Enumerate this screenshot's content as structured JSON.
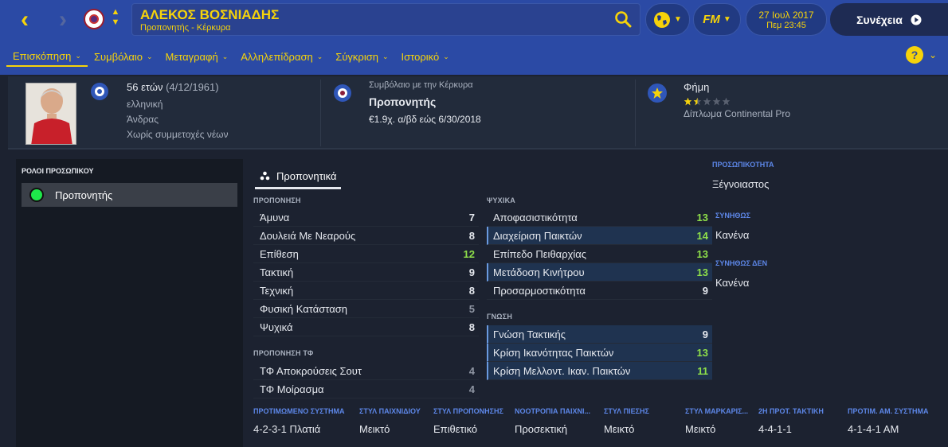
{
  "header": {
    "name": "ΑΛΕΚΟΣ ΒΟΣΝΙΑΔΗΣ",
    "subtitle": "Προπονητής - Κέρκυρα",
    "date": "27 Ιουλ 2017",
    "time": "Πεμ 23:45",
    "continue_label": "Συνέχεια",
    "fm_label": "FM",
    "icons": [
      "back-arrow",
      "forward-arrow",
      "club-badge",
      "up-down",
      "search",
      "globe",
      "fm-logo",
      "help"
    ]
  },
  "tabs": [
    "Επισκόπηση",
    "Συμβόλαιο",
    "Μεταγραφή",
    "Αλληλεπίδραση",
    "Σύγκριση",
    "Ιστορικό"
  ],
  "profile": {
    "age": "56 ετών",
    "dob": "(4/12/1961)",
    "nationality": "ελληνική",
    "gender": "Άνδρας",
    "youth": "Χωρίς συμμετοχές νέων",
    "contract_label": "Συμβόλαιο με την Κέρκυρα",
    "contract_role": "Προπονητής",
    "contract_terms": "€1.9χ. α/βδ εώς 6/30/2018",
    "reputation_label": "Φήμη",
    "reputation_stars": 1.5,
    "license": "Δίπλωμα Continental Pro"
  },
  "roles": {
    "header": "ΡΟΛΟΙ ΠΡΟΣΩΠΙΚΟΥ",
    "items": [
      {
        "label": "Προπονητής",
        "color": "#1ee84a"
      }
    ]
  },
  "attr_tab": "Προπονητικά",
  "coaching": {
    "header": "ΠΡΟΠΟΝΗΣΗ",
    "rows": [
      {
        "label": "Άμυνα",
        "value": "7"
      },
      {
        "label": "Δουλειά Με Νεαρούς",
        "value": "8"
      },
      {
        "label": "Επίθεση",
        "value": "12"
      },
      {
        "label": "Τακτική",
        "value": "9"
      },
      {
        "label": "Τεχνική",
        "value": "8"
      },
      {
        "label": "Φυσική Κατάσταση",
        "value": "5"
      },
      {
        "label": "Ψυχικά",
        "value": "8"
      }
    ]
  },
  "gk": {
    "header": "ΠΡΟΠΟΝΗΣΗ ΤΦ",
    "rows": [
      {
        "label": "ΤΦ Αποκρούσεις Σουτ",
        "value": "4"
      },
      {
        "label": "ΤΦ Μοίρασμα",
        "value": "4"
      }
    ]
  },
  "mental": {
    "header": "ΨΥΧΙΚΑ",
    "rows": [
      {
        "label": "Αποφασιστικότητα",
        "value": "13"
      },
      {
        "label": "Διαχείριση Παικτών",
        "value": "14"
      },
      {
        "label": "Επίπεδο Πειθαρχίας",
        "value": "13"
      },
      {
        "label": "Μετάδοση Κινήτρου",
        "value": "13"
      },
      {
        "label": "Προσαρμοστικότητα",
        "value": "9"
      }
    ]
  },
  "knowledge": {
    "header": "ΓΝΩΣΗ",
    "rows": [
      {
        "label": "Γνώση Τακτικής",
        "value": "9"
      },
      {
        "label": "Κρίση Ικανότητας Παικτών",
        "value": "13"
      },
      {
        "label": "Κρίση Μελλοντ. Ικαν. Παικτών",
        "value": "11"
      }
    ]
  },
  "personality": {
    "personality_h": "ΠΡΟΣΩΠΙΚΟΤΗΤΑ",
    "personality_v": "Ξέγνοιαστος",
    "likes_h": "ΣΥΝΗΘΩΣ",
    "likes_v": "Κανένα",
    "dislikes_h": "ΣΥΝΗΘΩΣ ΔΕΝ",
    "dislikes_v": "Κανένα"
  },
  "prefs": [
    {
      "h": "ΠΡΟΤΙΜΩΜΕΝΟ ΣΥΣΤΗΜΑ",
      "v": "4-2-3-1 Πλατιά"
    },
    {
      "h": "ΣΤΥΛ ΠΑΙΧΝΙΔΙΟΥ",
      "v": "Μεικτό"
    },
    {
      "h": "ΣΤΥΛ ΠΡΟΠΟΝΗΣΗΣ",
      "v": "Επιθετικό"
    },
    {
      "h": "ΝΟΟΤΡΟΠΙΑ ΠΑΙΧΝΙ...",
      "v": "Προσεκτική"
    },
    {
      "h": "ΣΤΥΛ ΠΙΕΣΗΣ",
      "v": "Μεικτό"
    },
    {
      "h": "ΣΤΥΛ ΜΑΡΚΑΡΙΣ...",
      "v": "Μεικτό"
    },
    {
      "h": "2Η ΠΡΟΤ. ΤΑΚΤΙΚΗ",
      "v": "4-4-1-1"
    },
    {
      "h": "ΠΡΟΤΙΜ. ΑΜ. ΣΥΣΤΗΜΑ",
      "v": "4-1-4-1 AM"
    }
  ],
  "colors": {
    "header_bg": "#2b4aa5",
    "accent": "#f6d30a",
    "high_value": "#8fe04a",
    "low_value": "#8f96a3"
  }
}
